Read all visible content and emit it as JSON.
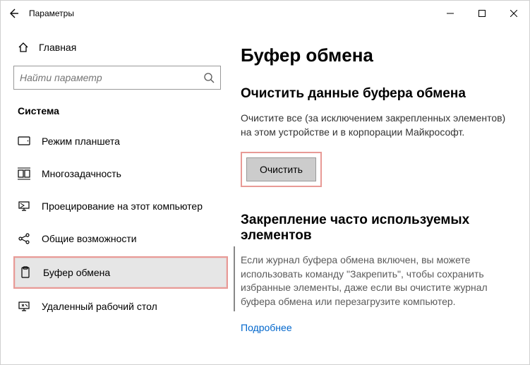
{
  "window": {
    "title": "Параметры"
  },
  "sidebar": {
    "home": "Главная",
    "search_placeholder": "Найти параметр",
    "heading": "Система",
    "items": [
      {
        "label": "Режим планшета"
      },
      {
        "label": "Многозадачность"
      },
      {
        "label": "Проецирование на этот компьютер"
      },
      {
        "label": "Общие возможности"
      },
      {
        "label": "Буфер обмена"
      },
      {
        "label": "Удаленный рабочий стол"
      }
    ]
  },
  "content": {
    "page_title": "Буфер обмена",
    "clear": {
      "title": "Очистить данные буфера обмена",
      "body": "Очистите все (за исключением закрепленных элементов) на этом устройстве и в корпорации Майкрософт.",
      "button": "Очистить"
    },
    "pin": {
      "title": "Закрепление часто используемых элементов",
      "body": "Если журнал буфера обмена включен, вы можете использовать команду \"Закрепить\", чтобы сохранить избранные элементы, даже если вы очистите журнал буфера обмена или перезагрузите компьютер.",
      "link": "Подробнее"
    }
  }
}
